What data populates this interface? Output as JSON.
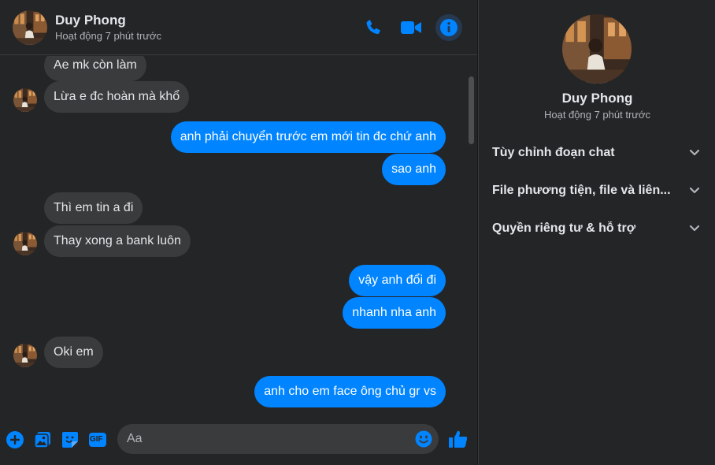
{
  "contact": {
    "name": "Duy Phong",
    "status": "Hoạt động 7 phút trước"
  },
  "header_icons": [
    "phone-icon",
    "video-camera-icon",
    "info-icon"
  ],
  "messages": [
    {
      "dir": "in",
      "text": "Ae mk còn làm"
    },
    {
      "dir": "in",
      "text": "Lừa e đc hoàn mà khổ"
    },
    {
      "dir": "out",
      "text": "anh phải chuyển trước em mới tin đc chứ anh"
    },
    {
      "dir": "out",
      "text": "sao anh"
    },
    {
      "dir": "in",
      "text": "Thì em tin a đi"
    },
    {
      "dir": "in",
      "text": "Thay xong a bank luôn"
    },
    {
      "dir": "out",
      "text": "vậy anh đổi đi"
    },
    {
      "dir": "out",
      "text": "nhanh nha anh"
    },
    {
      "dir": "in",
      "text": "Oki em"
    },
    {
      "dir": "out",
      "text": "anh cho em face ông chủ gr vs"
    }
  ],
  "composer": {
    "placeholder": "Aa",
    "icons": [
      "plus-circle-icon",
      "image-icon",
      "sticker-icon",
      "gif-icon",
      "emoji-icon",
      "thumbs-up-icon"
    ],
    "gif_label": "GIF"
  },
  "sidebar": {
    "name": "Duy Phong",
    "status": "Hoạt động 7 phút trước",
    "sections": [
      {
        "label": "Tùy chỉnh đoạn chat"
      },
      {
        "label": "File phương tiện, file và liên..."
      },
      {
        "label": "Quyền riêng tư & hỗ trợ"
      }
    ]
  },
  "colors": {
    "accent": "#0084ff",
    "background": "#242526",
    "incoming_bubble": "#3a3b3c",
    "text": "#e4e6eb",
    "muted": "#b0b3b8"
  }
}
